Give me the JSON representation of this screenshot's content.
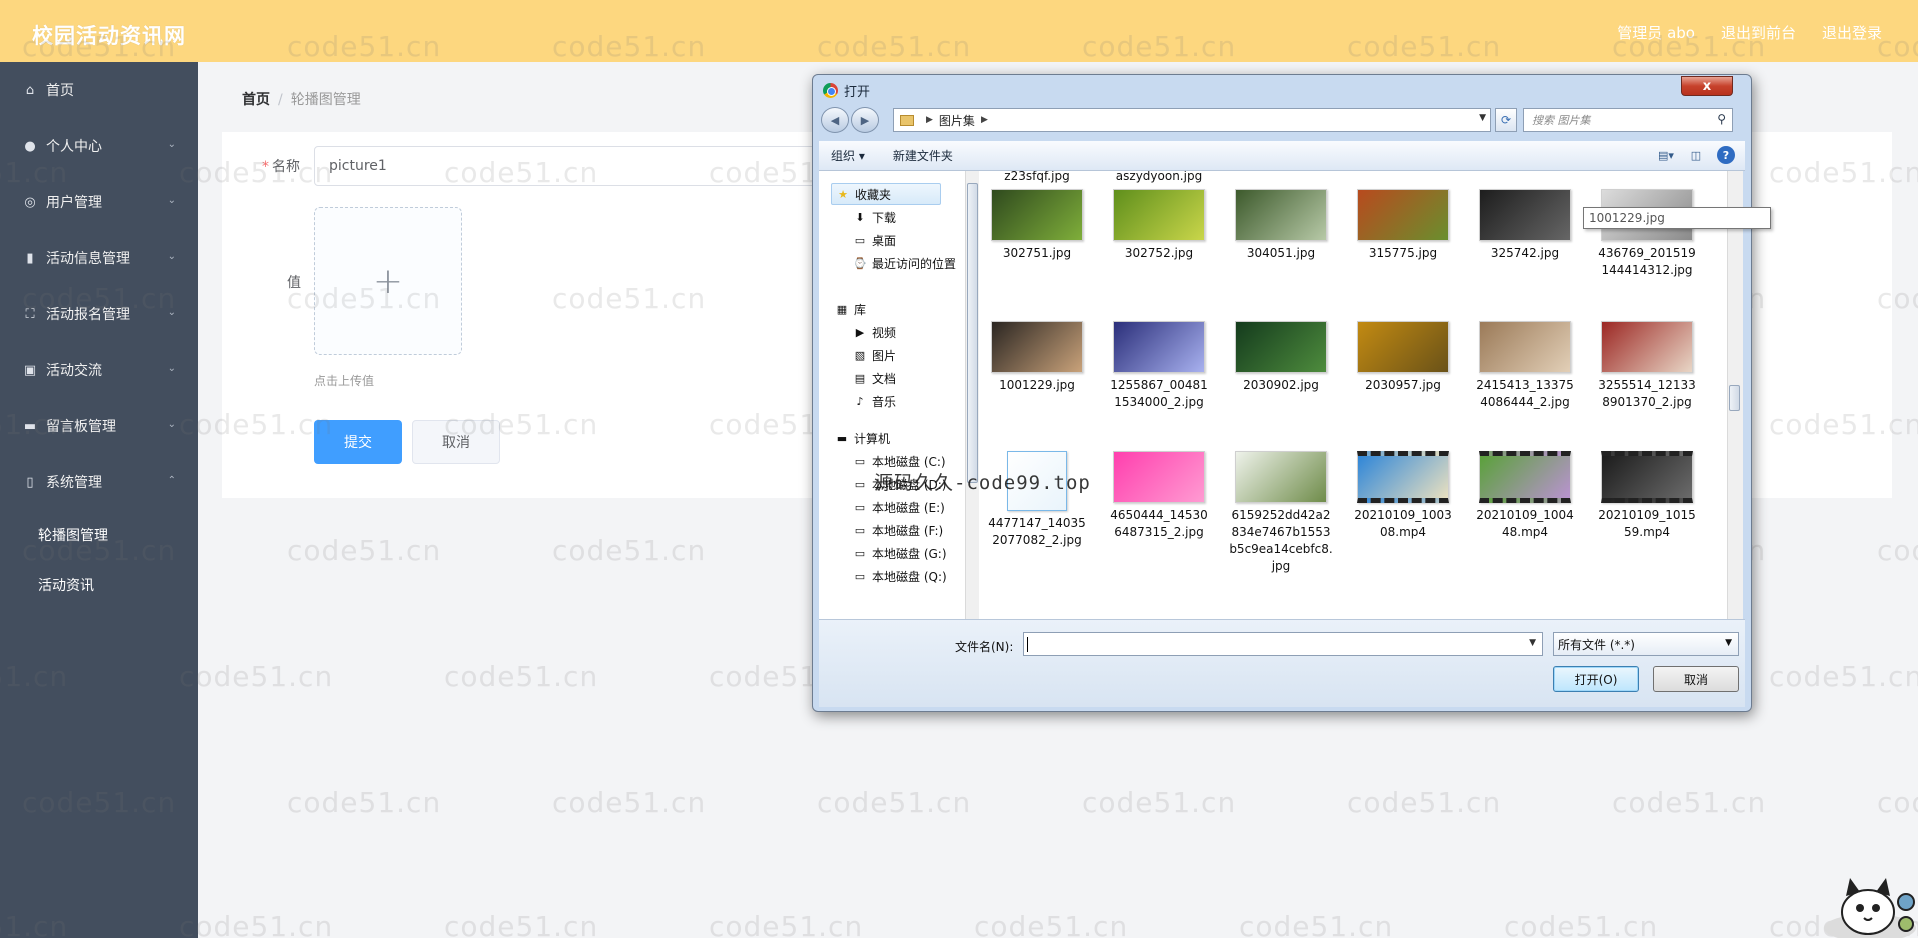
{
  "header": {
    "brand": "校园活动资讯网",
    "links": [
      "管理员 abo",
      "退出到前台",
      "退出登录"
    ]
  },
  "sidebar": {
    "items": [
      {
        "label": "首页",
        "icon": "home-icon",
        "glyph": "⌂",
        "chevron": ""
      },
      {
        "label": "个人中心",
        "icon": "user-icon",
        "glyph": "●",
        "chevron": "⌄"
      },
      {
        "label": "用户管理",
        "icon": "users-circle-icon",
        "glyph": "◎",
        "chevron": "⌄"
      },
      {
        "label": "活动信息管理",
        "icon": "bar-chart-icon",
        "glyph": "▮",
        "chevron": "⌄"
      },
      {
        "label": "活动报名管理",
        "icon": "scan-icon",
        "glyph": "⛶",
        "chevron": "⌄"
      },
      {
        "label": "活动交流",
        "icon": "clipboard-icon",
        "glyph": "▣",
        "chevron": "⌄"
      },
      {
        "label": "留言板管理",
        "icon": "monitor-icon",
        "glyph": "▬",
        "chevron": "⌄"
      },
      {
        "label": "系统管理",
        "icon": "phone-icon",
        "glyph": "▯",
        "chevron": "⌃"
      }
    ],
    "subitems": [
      "轮播图管理",
      "活动资讯"
    ]
  },
  "breadcrumb": {
    "home": "首页",
    "separator": "/",
    "current": "轮播图管理"
  },
  "form": {
    "name_label": "名称",
    "required_mark": "*",
    "name_value": "picture1",
    "value_label": "值",
    "upload_plus": "+",
    "upload_tip": "点击上传值",
    "submit": "提交",
    "cancel": "取消"
  },
  "watermark": {
    "text": "code51.cn",
    "overlay": "源码久久-code99.top"
  },
  "dialog": {
    "title": "打开",
    "close": "x",
    "path": "图片集",
    "search_placeholder": "搜索 图片集",
    "toolbar": {
      "organize": "组织 ▾",
      "new_folder": "新建文件夹"
    },
    "nav": {
      "favorites": {
        "label": "收藏夹",
        "items": [
          "下载",
          "桌面",
          "最近访问的位置"
        ]
      },
      "library": {
        "label": "库",
        "items": [
          "视频",
          "图片",
          "文档",
          "音乐"
        ]
      },
      "computer": {
        "label": "计算机",
        "items": [
          "本地磁盘 (C:)",
          "本地磁盘 (D:)",
          "本地磁盘 (E:)",
          "本地磁盘 (F:)",
          "本地磁盘 (G:)",
          "本地磁盘 (Q:)"
        ]
      }
    },
    "partial_row": [
      "z23sfqf.jpg",
      "aszydyoon.jpg"
    ],
    "files": [
      {
        "name": "302751.jpg",
        "colors": [
          "#2f4a1e",
          "#7fae3a"
        ]
      },
      {
        "name": "302752.jpg",
        "colors": [
          "#5f8f1c",
          "#c9d64a"
        ]
      },
      {
        "name": "304051.jpg",
        "colors": [
          "#3d5a2c",
          "#b7c9a7"
        ]
      },
      {
        "name": "315775.jpg",
        "colors": [
          "#b84a1e",
          "#6a8f2e"
        ]
      },
      {
        "name": "325742.jpg",
        "colors": [
          "#1d1d1d",
          "#666666"
        ]
      },
      {
        "name": "436769_201519144414312.jpg",
        "colors": [
          "#dcdcdc",
          "#8a8a8a"
        ]
      },
      {
        "name": "1001229.jpg",
        "colors": [
          "#2b2622",
          "#c9a27a"
        ]
      },
      {
        "name": "1255867_004811534000_2.jpg",
        "colors": [
          "#2b2f7a",
          "#a8b1ef"
        ]
      },
      {
        "name": "2030902.jpg",
        "colors": [
          "#143b1d",
          "#4e8c3d"
        ]
      },
      {
        "name": "2030957.jpg",
        "colors": [
          "#c28a12",
          "#6a5218"
        ]
      },
      {
        "name": "2415413_133754086444_2.jpg",
        "colors": [
          "#9b7a58",
          "#e2cfb7"
        ]
      },
      {
        "name": "3255514_121338901370_2.jpg",
        "colors": [
          "#9c2824",
          "#e8d6c6"
        ]
      },
      {
        "name": "4477147_140352077082_2.jpg",
        "colors": [
          "#ffffff",
          "#e9f4fb"
        ]
      },
      {
        "name": "4650444_145306487315_2.jpg",
        "colors": [
          "#ff3fae",
          "#ff9bd2"
        ]
      },
      {
        "name": "6159252dd42a2834e7467b1553b5c9ea14cebfc8.jpg",
        "colors": [
          "#eef2ea",
          "#6f8c4a"
        ]
      },
      {
        "name": "20210109_100308.mp4",
        "colors": [
          "#2f86d8",
          "#e9e0c0"
        ]
      },
      {
        "name": "20210109_100448.mp4",
        "colors": [
          "#5aa13a",
          "#b993d0"
        ]
      },
      {
        "name": "20210109_101559.mp4",
        "colors": [
          "#1c1c1c",
          "#6b6b6b"
        ]
      }
    ],
    "tooltip": "1001229.jpg",
    "filename_label": "文件名(N):",
    "filename_value": "",
    "filetype": "所有文件 (*.*)",
    "open": "打开(O)",
    "cancel": "取消"
  }
}
